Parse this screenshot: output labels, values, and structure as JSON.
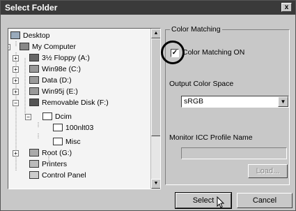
{
  "window": {
    "title": "Select Folder",
    "close_label": "x"
  },
  "tree": {
    "items": [
      {
        "label": "Desktop",
        "icon": "desktop-icon"
      },
      {
        "label": "My Computer",
        "icon": "computer-icon",
        "expander": "−"
      },
      {
        "label": "3½ Floppy (A:)",
        "icon": "floppy-icon",
        "expander": "+"
      },
      {
        "label": "Win98e (C:)",
        "icon": "drive-icon",
        "expander": "+"
      },
      {
        "label": "Data (D:)",
        "icon": "drive-icon",
        "expander": "+"
      },
      {
        "label": "Win95j (E:)",
        "icon": "drive-icon",
        "expander": "+"
      },
      {
        "label": "Removable Disk (F:)",
        "icon": "removable-disk-icon",
        "expander": "−"
      },
      {
        "label": "Dcim",
        "icon": "folder-icon",
        "expander": "−"
      },
      {
        "label": "100nlt03",
        "icon": "folder-icon"
      },
      {
        "label": "Misc",
        "icon": "folder-icon"
      },
      {
        "label": "Root (G:)",
        "icon": "network-drive-icon",
        "expander": "+"
      },
      {
        "label": "Printers",
        "icon": "printer-icon"
      },
      {
        "label": "Control Panel",
        "icon": "control-panel-icon"
      }
    ]
  },
  "color_matching": {
    "group_title": "Color Matching",
    "checkbox_label": "Color Matching ON",
    "checked": true,
    "output_label": "Output Color Space",
    "output_value": "sRGB",
    "monitor_label": "Monitor ICC Profile Name",
    "monitor_value": "",
    "load_label": "Load..."
  },
  "buttons": {
    "select": "Select",
    "cancel": "Cancel"
  }
}
